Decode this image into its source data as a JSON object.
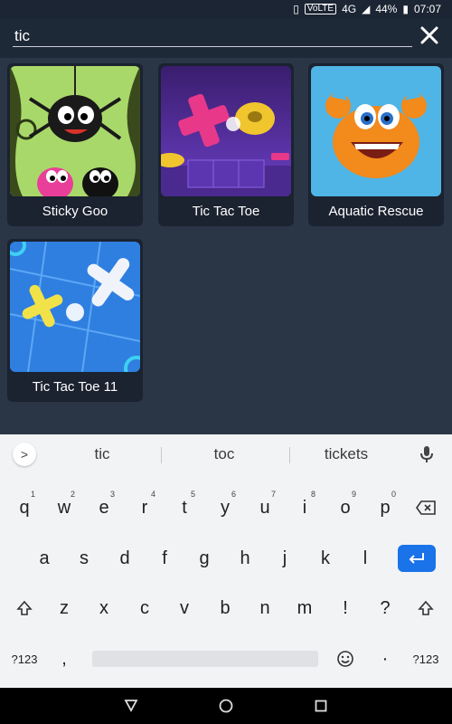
{
  "status": {
    "volte": "VoLTE",
    "network": "4G",
    "battery": "44%",
    "time": "07:07"
  },
  "search": {
    "value": "tic"
  },
  "results": [
    {
      "title": "Sticky Goo"
    },
    {
      "title": "Tic Tac Toe"
    },
    {
      "title": "Aquatic Rescue"
    },
    {
      "title": "Tic Tac Toe 11"
    }
  ],
  "keyboard": {
    "suggestions": [
      "tic",
      "toc",
      "tickets"
    ],
    "row1": [
      {
        "k": "q",
        "n": "1"
      },
      {
        "k": "w",
        "n": "2"
      },
      {
        "k": "e",
        "n": "3"
      },
      {
        "k": "r",
        "n": "4"
      },
      {
        "k": "t",
        "n": "5"
      },
      {
        "k": "y",
        "n": "6"
      },
      {
        "k": "u",
        "n": "7"
      },
      {
        "k": "i",
        "n": "8"
      },
      {
        "k": "o",
        "n": "9"
      },
      {
        "k": "p",
        "n": "0"
      }
    ],
    "row2": [
      "a",
      "s",
      "d",
      "f",
      "g",
      "h",
      "j",
      "k",
      "l"
    ],
    "row3": [
      "z",
      "x",
      "c",
      "v",
      "b",
      "n",
      "m",
      "!",
      "?"
    ],
    "symbols_label": "?123",
    "comma": ",",
    "period": "·",
    "symbols_label_right": "?123"
  },
  "colors": {
    "accent": "#1a73e8",
    "background": "#2a3546",
    "card": "#1b2230"
  }
}
